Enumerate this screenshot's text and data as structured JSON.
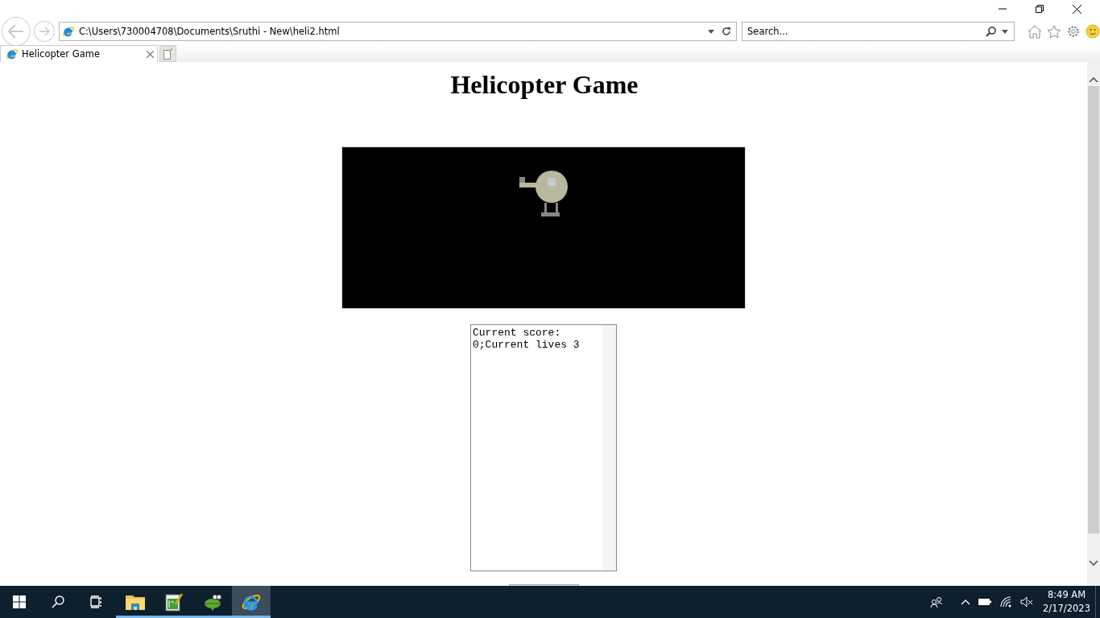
{
  "address_bar": {
    "url": "C:\\Users\\730004708\\Documents\\Sruthi - New\\heli2.html"
  },
  "search": {
    "placeholder": "Search..."
  },
  "tabs": [
    {
      "label": "Helicopter Game",
      "selected": true
    }
  ],
  "page": {
    "heading": "Helicopter Game",
    "log": "Current score: 0;Current lives 3"
  },
  "taskbar": {
    "apps": [
      {
        "kind": "folder",
        "running": true,
        "selected": false
      },
      {
        "kind": "notepad",
        "running": true,
        "selected": false
      },
      {
        "kind": "frog",
        "running": true,
        "selected": false
      },
      {
        "kind": "browser",
        "running": true,
        "selected": true
      }
    ],
    "clock": {
      "time": "8:49 AM",
      "date": "2/17/2023"
    }
  }
}
